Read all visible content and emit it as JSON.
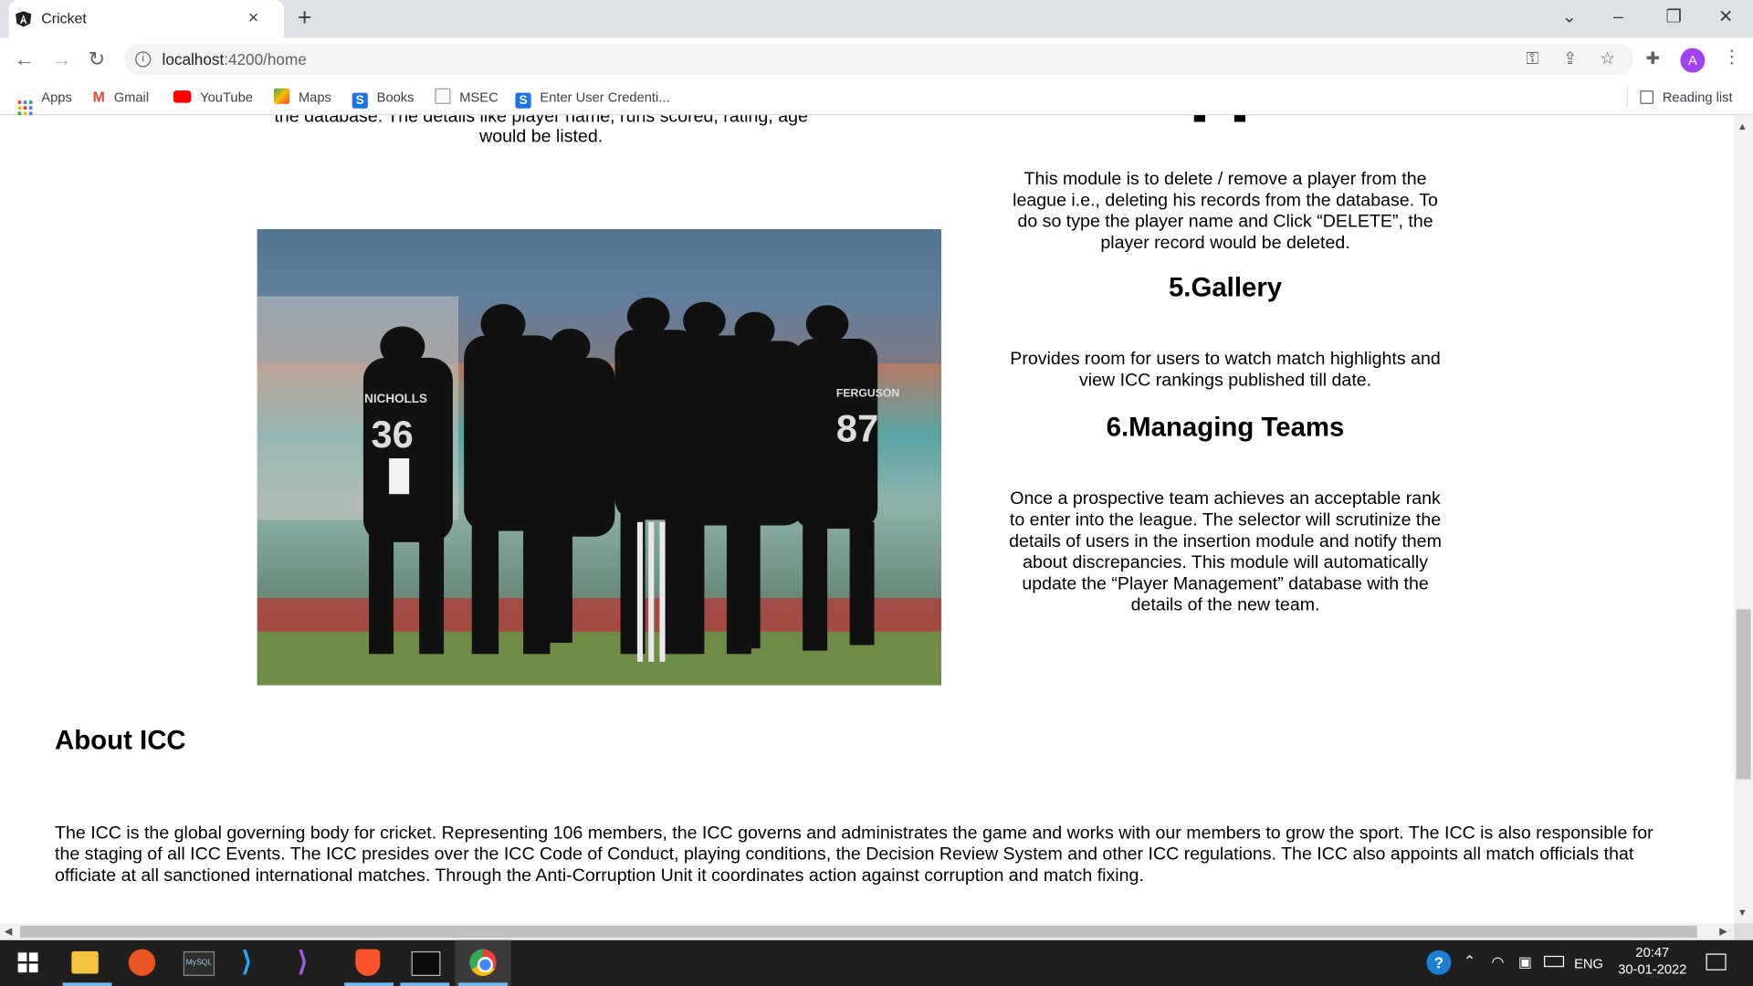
{
  "browser": {
    "tab_title": "Cricket",
    "tab_close": "×",
    "new_tab": "+",
    "url_host": "localhost",
    "url_path": ":4200/home",
    "bookmarks": [
      "Apps",
      "Gmail",
      "YouTube",
      "Maps",
      "Books",
      "MSEC",
      "Enter User Credenti..."
    ],
    "reading_list": "Reading list",
    "profile_initial": "A"
  },
  "content": {
    "top_cutoff_text_1": "the database. The details like player name, runs scored, rating, age",
    "top_cutoff_text_2": "would be listed.",
    "delete_module_text": "This module is to delete / remove a player from the league i.e., deleting his records from the database. To do so type the player name and Click “DELETE”, the player record would be deleted.",
    "gallery_heading": "5.Gallery",
    "gallery_text": "Provides room for users to watch match highlights and view ICC rankings published till date.",
    "teams_heading": "6.Managing Teams",
    "teams_text": "Once a prospective team achieves an acceptable rank to enter into the league. The selector will scrutinize the details of users in the insertion module and notify them about discrepancies. This module will automatically update the “Player Management” database with the details of the new team.",
    "about_heading": "About ICC",
    "about_text": "The ICC is the global governing body for cricket. Representing 106 members, the ICC governs and administrates the game and works with our members to grow the sport. The ICC is also responsible for the staging of all ICC Events. The ICC presides over the ICC Code of Conduct, playing conditions, the Decision Review System and other ICC regulations. The ICC also appoints all match officials that officiate at all sanctioned international matches. Through the Anti-Corruption Unit it coordinates action against corruption and match fixing.",
    "jersey_names": [
      "NICHOLLS",
      "FERGUSON"
    ],
    "jersey_numbers": [
      "36",
      "87"
    ]
  },
  "taskbar": {
    "language": "ENG",
    "time": "20:47",
    "date": "30-01-2022"
  }
}
